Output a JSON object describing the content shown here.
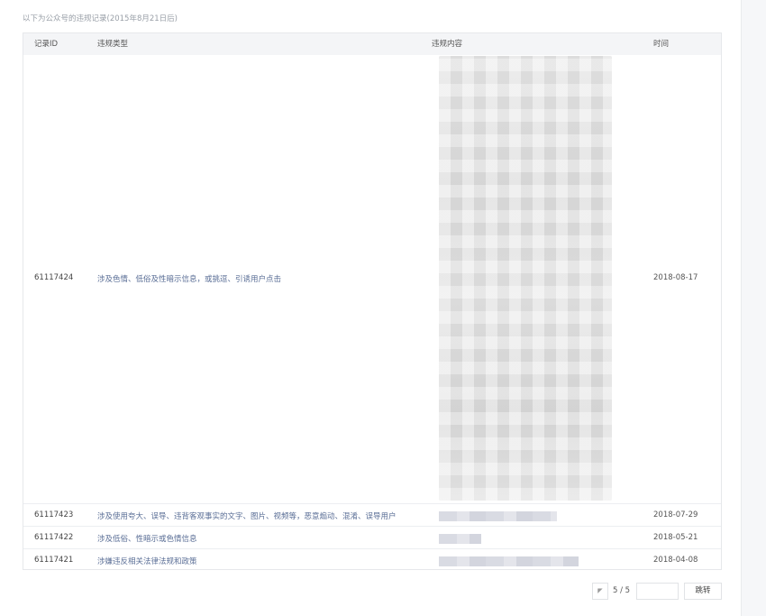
{
  "notice": "以下为公众号的违规记录(2015年8月21日后)",
  "table": {
    "headers": [
      "记录ID",
      "违规类型",
      "违规内容",
      "时间"
    ],
    "rows": [
      {
        "id": "61117424",
        "type": "涉及色情、低俗及性暗示信息，或挑逗、引诱用户点击",
        "date": "2018-08-17"
      },
      {
        "id": "61117423",
        "type": "涉及使用夸大、误导、违背客观事实的文字、图片、视频等，恶意煽动、混淆、误导用户",
        "date": "2018-07-29"
      },
      {
        "id": "61117422",
        "type": "涉及低俗、性暗示或色情信息",
        "date": "2018-05-21"
      },
      {
        "id": "61117421",
        "type": "涉嫌违反相关法律法规和政策",
        "date": "2018-04-08"
      }
    ]
  },
  "pagination": {
    "prev_icon": "◤",
    "page_info": "5 / 5",
    "jump_label": "跳转",
    "input_value": ""
  }
}
